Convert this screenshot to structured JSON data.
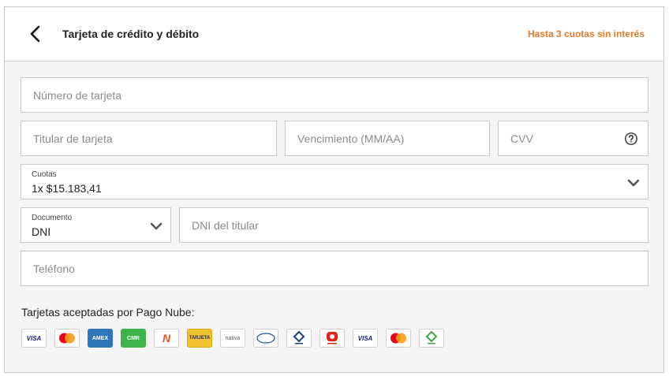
{
  "header": {
    "title": "Tarjeta de crédito y débito",
    "promo": "Hasta 3 cuotas sin interés"
  },
  "form": {
    "card_number_placeholder": "Número de tarjeta",
    "holder_placeholder": "Titular de tarjeta",
    "expiry_placeholder": "Vencimiento (MM/AA)",
    "cvv_placeholder": "CVV",
    "installments_label": "Cuotas",
    "installments_value": "1x $15.183,41",
    "document_label": "Documento",
    "document_value": "DNI",
    "dni_placeholder": "DNI del titular",
    "phone_placeholder": "Teléfono"
  },
  "accepted": {
    "label": "Tarjetas aceptadas por Pago Nube:",
    "cards": [
      {
        "name": "visa-icon",
        "text": "VISA"
      },
      {
        "name": "mastercard-icon",
        "text": ""
      },
      {
        "name": "amex-icon",
        "text": "AMEX"
      },
      {
        "name": "cmr-icon",
        "text": "CMR"
      },
      {
        "name": "naranja-icon",
        "text": "N"
      },
      {
        "name": "tarjeta-shopping-icon",
        "text": "TARJETA"
      },
      {
        "name": "nativa-icon",
        "text": "nativa"
      },
      {
        "name": "cencosud-icon",
        "text": "cencosud"
      },
      {
        "name": "cabal-icon",
        "text": "CABAL"
      },
      {
        "name": "argencard-icon",
        "text": "a"
      },
      {
        "name": "visa-debit-icon",
        "text": "VISA"
      },
      {
        "name": "maestro-icon",
        "text": ""
      },
      {
        "name": "cabal-debit-icon",
        "text": "CABAL"
      }
    ]
  },
  "colors": {
    "accent": "#e07b2a",
    "panel_bg": "#f5f5f5",
    "border": "#c8c8c8"
  }
}
